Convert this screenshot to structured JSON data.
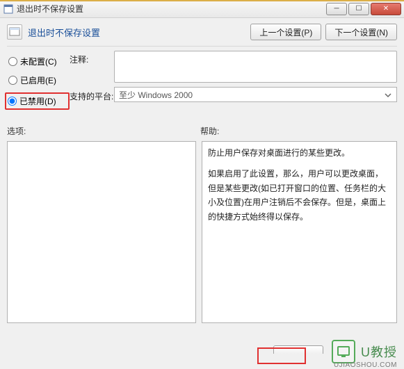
{
  "window": {
    "title": "退出时不保存设置",
    "min": "─",
    "max": "☐",
    "close": "✕"
  },
  "header": {
    "title": "退出时不保存设置",
    "prev": "上一个设置(P)",
    "next": "下一个设置(N)"
  },
  "radios": {
    "not_configured": "未配置(C)",
    "enabled": "已启用(E)",
    "disabled": "已禁用(D)",
    "selected": "disabled"
  },
  "form": {
    "comment_label": "注释:",
    "comment_value": "",
    "platform_label": "支持的平台:",
    "platform_value": "至少 Windows 2000"
  },
  "panels": {
    "options_label": "选项:",
    "help_label": "帮助:",
    "help_p1": "防止用户保存对桌面进行的某些更改。",
    "help_p2": "如果启用了此设置，那么，用户可以更改桌面，但是某些更改(如已打开窗口的位置、任务栏的大小及位置)在用户注销后不会保存。但是，桌面上的快捷方式始终得以保存。"
  },
  "watermark": {
    "brand": "U教授",
    "url": "UJIAOSHOU.COM"
  }
}
